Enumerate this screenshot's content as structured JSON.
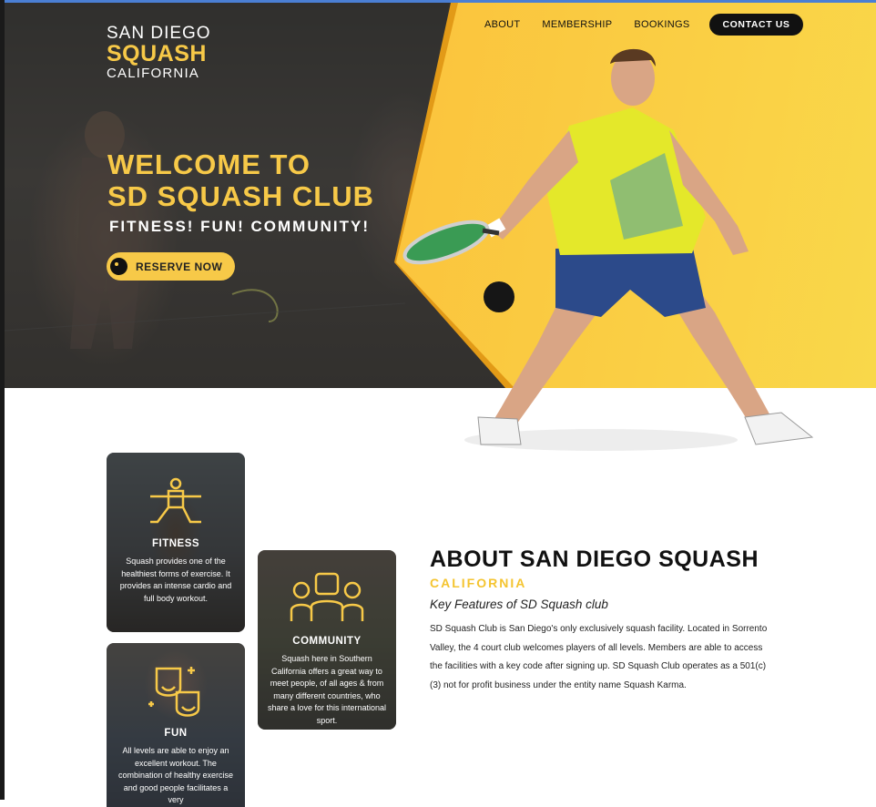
{
  "brand": {
    "line1": "SAN DIEGO",
    "line2": "SQUASH",
    "line3": "CALIFORNIA"
  },
  "nav": {
    "about": "ABOUT",
    "membership": "MEMBERSHIP",
    "bookings": "BOOKINGS",
    "contact": "CONTACT US"
  },
  "hero": {
    "title_line1": "WELCOME TO",
    "title_line2": "SD SQUASH CLUB",
    "tagline": "FITNESS! FUN! COMMUNITY!",
    "cta": "RESERVE NOW"
  },
  "cards": {
    "fitness": {
      "title": "FITNESS",
      "text": "Squash provides one of the healthiest forms of exercise. It provides an intense cardio and full body workout.",
      "icon": "yoga-pose-icon"
    },
    "community": {
      "title": "COMMUNITY",
      "text": "Squash here in Southern California offers a great way to meet people, of all ages & from many different countries, who share a love for this international sport.",
      "icon": "group-people-icon"
    },
    "fun": {
      "title": "FUN",
      "text": "All levels are able to enjoy an excellent workout. The combination of healthy exercise and good people facilitates a very",
      "icon": "happy-faces-icon"
    }
  },
  "about": {
    "title": "ABOUT SAN DIEGO SQUASH",
    "subtitle": "CALIFORNIA",
    "key": "Key Features of SD Squash club",
    "body": "SD Squash Club is San Diego's only exclusively squash facility. Located in Sorrento Valley, the 4 court club welcomes players of all levels. Members are able to access the facilities with a key code after signing up. SD Squash Club operates as a 501(c)(3) not for profit business under the entity name Squash Karma."
  },
  "colors": {
    "accent": "#f7c948",
    "orange": "#f6ae2d",
    "dark": "#111111",
    "topline": "#4a7fd4"
  }
}
